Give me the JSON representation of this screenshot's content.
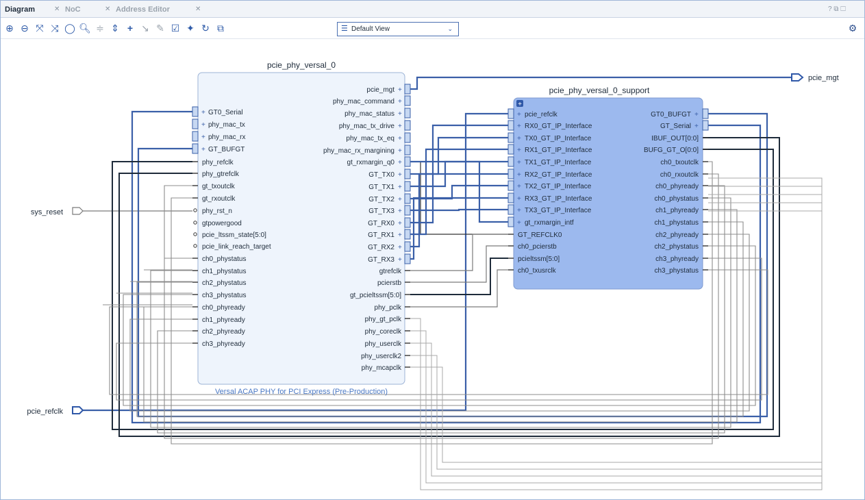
{
  "tabs": [
    {
      "label": "Diagram"
    },
    {
      "label": "NoC"
    },
    {
      "label": "Address Editor"
    }
  ],
  "window_controls": "? ⧉ ☐",
  "toolbar": {
    "view_select": "Default View"
  },
  "ports": {
    "sys_reset": "sys_reset",
    "pcie_refclk": "pcie_refclk",
    "pcie_mgt": "pcie_mgt"
  },
  "block_main": {
    "instance": "pcie_phy_versal_0",
    "subtitle": "Versal ACAP PHY for PCI Express (Pre-Production)",
    "left_pins": [
      "GT0_Serial",
      "phy_mac_tx",
      "phy_mac_rx",
      "GT_BUFGT",
      "phy_refclk",
      "phy_gtrefclk",
      "gt_txoutclk",
      "gt_rxoutclk",
      "phy_rst_n",
      "gtpowergood",
      "pcie_ltssm_state[5:0]",
      "pcie_link_reach_target",
      "ch0_phystatus",
      "ch1_phystatus",
      "ch2_phystatus",
      "ch3_phystatus",
      "ch0_phyready",
      "ch1_phyready",
      "ch2_phyready",
      "ch3_phyready"
    ],
    "right_pins": [
      "pcie_mgt",
      "phy_mac_command",
      "phy_mac_status",
      "phy_mac_tx_drive",
      "phy_mac_tx_eq",
      "phy_mac_rx_margining",
      "gt_rxmargin_q0",
      "GT_TX0",
      "GT_TX1",
      "GT_TX2",
      "GT_TX3",
      "GT_RX0",
      "GT_RX1",
      "GT_RX2",
      "GT_RX3",
      "gtrefclk",
      "pcierstb",
      "gt_pcieltssm[5:0]",
      "phy_pclk",
      "phy_gt_pclk",
      "phy_coreclk",
      "phy_userclk",
      "phy_userclk2",
      "phy_mcapclk"
    ]
  },
  "block_support": {
    "instance": "pcie_phy_versal_0_support",
    "left_pins": [
      "pcie_refclk",
      "RX0_GT_IP_Interface",
      "TX0_GT_IP_Interface",
      "RX1_GT_IP_Interface",
      "TX1_GT_IP_Interface",
      "RX2_GT_IP_Interface",
      "TX2_GT_IP_Interface",
      "RX3_GT_IP_Interface",
      "TX3_GT_IP_Interface",
      "gt_rxmargin_intf",
      "GT_REFCLK0",
      "ch0_pcierstb",
      "pcieltssm[5:0]",
      "ch0_txusrclk"
    ],
    "right_pins": [
      "GT0_BUFGT",
      "GT_Serial",
      "IBUF_OUT[0:0]",
      "BUFG_GT_O[0:0]",
      "ch0_txoutclk",
      "ch0_rxoutclk",
      "ch0_phyready",
      "ch0_phystatus",
      "ch1_phyready",
      "ch1_phystatus",
      "ch2_phyready",
      "ch2_phystatus",
      "ch3_phyready",
      "ch3_phystatus"
    ]
  },
  "colors": {
    "bus": "#3a5fa8",
    "wire": "#9a9a9a",
    "dark": "#1e2b3a",
    "block_fill": "#eef4fc",
    "support_fill": "#9cb9ee"
  }
}
